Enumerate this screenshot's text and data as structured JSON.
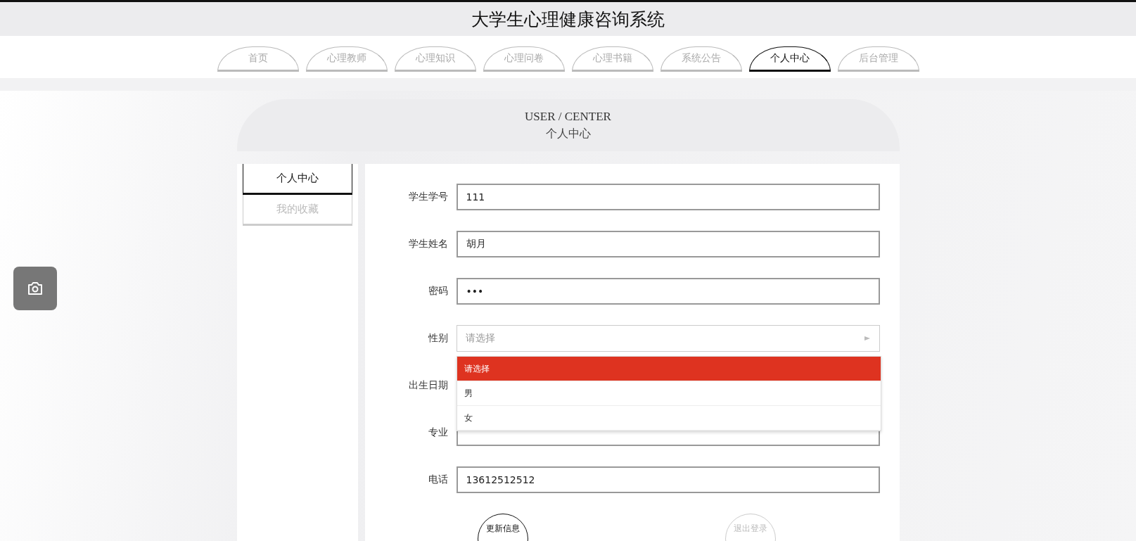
{
  "site_title": "大学生心理健康咨询系统",
  "nav": [
    {
      "label": "首页",
      "selected": false
    },
    {
      "label": "心理教师",
      "selected": false
    },
    {
      "label": "心理知识",
      "selected": false
    },
    {
      "label": "心理问卷",
      "selected": false
    },
    {
      "label": "心理书籍",
      "selected": false
    },
    {
      "label": "系统公告",
      "selected": false
    },
    {
      "label": "个人中心",
      "selected": true
    },
    {
      "label": "后台管理",
      "selected": false
    }
  ],
  "page_header": {
    "subtitle": "USER / CENTER",
    "title": "个人中心"
  },
  "sidebar": [
    {
      "label": "个人中心",
      "selected": true
    },
    {
      "label": "我的收藏",
      "selected": false
    }
  ],
  "form": [
    {
      "label": "学生学号",
      "kind": "text",
      "value": "111"
    },
    {
      "label": "学生姓名",
      "kind": "text",
      "value": "胡月"
    },
    {
      "label": "密码",
      "kind": "password",
      "value": "•••"
    },
    {
      "label": "性别",
      "kind": "select",
      "placeholder": "请选择",
      "expanded": true,
      "options": [
        {
          "label": "请选择",
          "selected": true
        },
        {
          "label": "男",
          "selected": false
        },
        {
          "label": "女",
          "selected": false
        }
      ]
    },
    {
      "label": "出生日期",
      "kind": "covered"
    },
    {
      "label": "专业",
      "kind": "covered"
    },
    {
      "label": "电话",
      "kind": "text",
      "value": "13612512512"
    }
  ],
  "buttons": [
    {
      "label": "更新信息",
      "kind": "primary"
    },
    {
      "label": "退出登录",
      "kind": "secondary"
    }
  ]
}
